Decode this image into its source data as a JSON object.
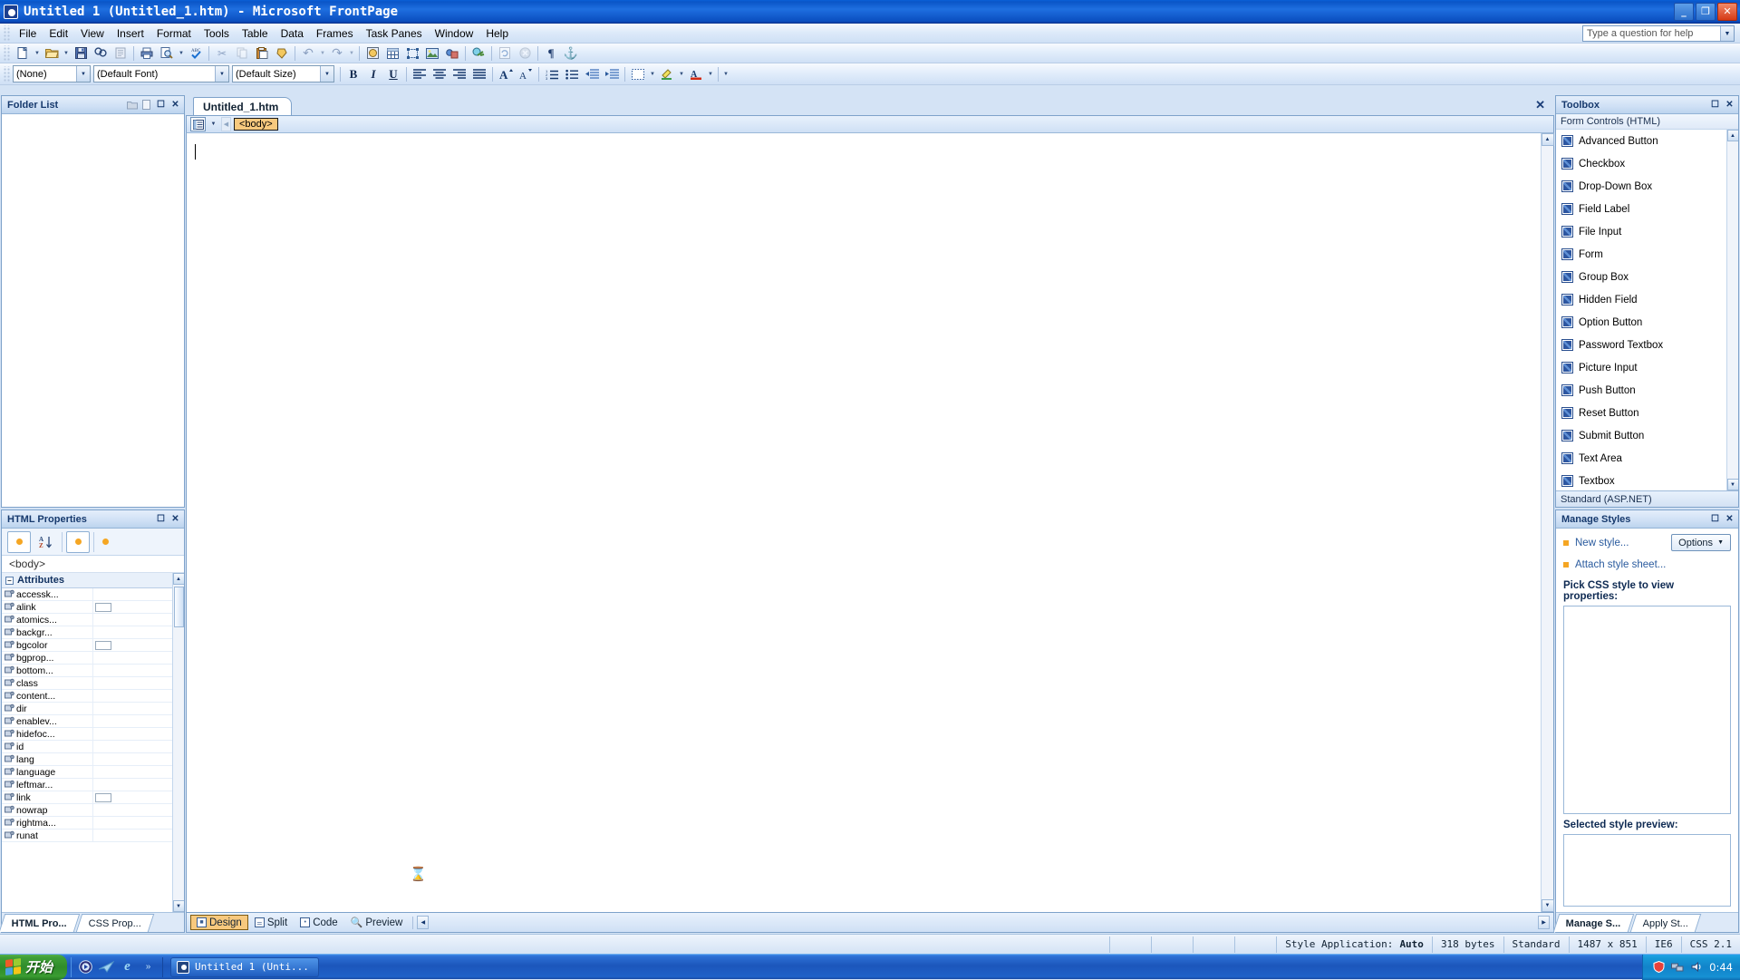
{
  "window": {
    "title": "Untitled 1 (Untitled_1.htm) - Microsoft FrontPage",
    "icon": "frontpage-icon",
    "minimize": "_",
    "maximize": "❐",
    "close": "✕"
  },
  "menubar": {
    "items": [
      "File",
      "Edit",
      "View",
      "Insert",
      "Format",
      "Tools",
      "Table",
      "Data",
      "Frames",
      "Task Panes",
      "Window",
      "Help"
    ],
    "help_box": {
      "placeholder": "Type a question for help",
      "value": ""
    }
  },
  "standard_toolbar": {
    "buttons": [
      {
        "name": "new-page-button",
        "glyph": "□"
      },
      {
        "name": "new-page-dropdown",
        "glyph": "▾"
      },
      {
        "name": "open-button",
        "glyph": "📂"
      },
      {
        "name": "open-dropdown",
        "glyph": "▾"
      },
      {
        "name": "save-button",
        "glyph": "💾"
      },
      {
        "name": "search-button",
        "glyph": "🔍"
      },
      {
        "name": "publish-site-button",
        "glyph": "≣"
      },
      {
        "name": "print-button",
        "glyph": "🖨"
      },
      {
        "name": "print-preview-button",
        "glyph": "🔎"
      },
      {
        "name": "print-preview-dropdown",
        "glyph": "▾"
      },
      {
        "name": "spelling-button",
        "glyph": "✔"
      },
      {
        "name": "cut-button",
        "glyph": "✂"
      },
      {
        "name": "copy-button",
        "glyph": "❐"
      },
      {
        "name": "paste-button",
        "glyph": "📋"
      },
      {
        "name": "format-painter-button",
        "glyph": "✒"
      },
      {
        "name": "undo-button",
        "glyph": "↶"
      },
      {
        "name": "undo-dropdown",
        "glyph": "▾"
      },
      {
        "name": "redo-button",
        "glyph": "↷"
      },
      {
        "name": "redo-dropdown",
        "glyph": "▾"
      },
      {
        "name": "web-component-button",
        "glyph": "🌐"
      },
      {
        "name": "insert-table-button",
        "glyph": "▦"
      },
      {
        "name": "insert-layer-button",
        "glyph": "⬚"
      },
      {
        "name": "insert-picture-button",
        "glyph": "🖼"
      },
      {
        "name": "drawing-button",
        "glyph": "✎"
      },
      {
        "name": "insert-hyperlink-button",
        "glyph": "🔗"
      },
      {
        "name": "refresh-button",
        "glyph": "❐"
      },
      {
        "name": "stop-button",
        "glyph": "✕"
      },
      {
        "name": "show-marks-button",
        "glyph": "¶"
      },
      {
        "name": "show-anchors-button",
        "glyph": "⚓"
      }
    ]
  },
  "formatting_toolbar": {
    "style_combo": {
      "value": "(None)",
      "name": "style-combo"
    },
    "font_combo": {
      "value": "(Default Font)",
      "name": "font-combo"
    },
    "size_combo": {
      "value": "(Default Size)",
      "name": "font-size-combo"
    },
    "bold": "B",
    "italic": "I",
    "underline": "U",
    "buttons": [
      {
        "name": "align-left-button",
        "glyph": "≡"
      },
      {
        "name": "align-center-button",
        "glyph": "≡"
      },
      {
        "name": "align-right-button",
        "glyph": "≡"
      },
      {
        "name": "justify-button",
        "glyph": "≡"
      },
      {
        "name": "increase-font-size-button",
        "glyph": "A"
      },
      {
        "name": "decrease-font-size-button",
        "glyph": "A"
      },
      {
        "name": "numbered-list-button",
        "glyph": "≡"
      },
      {
        "name": "bulleted-list-button",
        "glyph": "≡"
      },
      {
        "name": "decrease-indent-button",
        "glyph": "⇤"
      },
      {
        "name": "increase-indent-button",
        "glyph": "⇥"
      },
      {
        "name": "borders-button",
        "glyph": "⬚"
      },
      {
        "name": "borders-dropdown",
        "glyph": "▾"
      },
      {
        "name": "highlight-button",
        "glyph": "✏"
      },
      {
        "name": "highlight-dropdown",
        "glyph": "▾"
      },
      {
        "name": "font-color-button",
        "glyph": "A"
      },
      {
        "name": "font-color-dropdown",
        "glyph": "▾"
      },
      {
        "name": "toolbar-options-button",
        "glyph": "▾"
      }
    ]
  },
  "folder_list": {
    "title": "Folder List",
    "header_icons": [
      "new-folder-icon",
      "new-page-icon",
      "maximize-icon",
      "close-icon"
    ],
    "items": []
  },
  "html_properties": {
    "title": "HTML Properties",
    "header_icons": [
      "maximize-icon",
      "close-icon"
    ],
    "toolbar": [
      "categorized-button",
      "alphabetical-button",
      "properties-button",
      "events-button"
    ],
    "az_label": "AZ",
    "selected_tag": "<body>",
    "attributes_group": "Attributes",
    "attributes": [
      {
        "name": "accessk...",
        "value": "",
        "has_swatch": false
      },
      {
        "name": "alink",
        "value": "",
        "has_swatch": true
      },
      {
        "name": "atomics...",
        "value": "",
        "has_swatch": false
      },
      {
        "name": "backgr...",
        "value": "",
        "has_swatch": false
      },
      {
        "name": "bgcolor",
        "value": "",
        "has_swatch": true
      },
      {
        "name": "bgprop...",
        "value": "",
        "has_swatch": false
      },
      {
        "name": "bottom...",
        "value": "",
        "has_swatch": false
      },
      {
        "name": "class",
        "value": "",
        "has_swatch": false
      },
      {
        "name": "content...",
        "value": "",
        "has_swatch": false
      },
      {
        "name": "dir",
        "value": "",
        "has_swatch": false
      },
      {
        "name": "enablev...",
        "value": "",
        "has_swatch": false
      },
      {
        "name": "hidefoc...",
        "value": "",
        "has_swatch": false
      },
      {
        "name": "id",
        "value": "",
        "has_swatch": false
      },
      {
        "name": "lang",
        "value": "",
        "has_swatch": false
      },
      {
        "name": "language",
        "value": "",
        "has_swatch": false
      },
      {
        "name": "leftmar...",
        "value": "",
        "has_swatch": false
      },
      {
        "name": "link",
        "value": "",
        "has_swatch": true
      },
      {
        "name": "nowrap",
        "value": "",
        "has_swatch": false
      },
      {
        "name": "rightma...",
        "value": "",
        "has_swatch": false
      },
      {
        "name": "runat",
        "value": "",
        "has_swatch": false
      }
    ],
    "tabs": [
      {
        "label": "HTML Pro...",
        "active": true
      },
      {
        "label": "CSS Prop...",
        "active": false
      }
    ]
  },
  "document": {
    "tab_label": "Untitled_1.htm",
    "close_label": "✕",
    "quick_tag_selector": "<body>",
    "canvas_text": "",
    "hourglass_icon": "⌛"
  },
  "view_tabs": [
    {
      "label": "Design",
      "active": true,
      "icon": "design-icon"
    },
    {
      "label": "Split",
      "active": false,
      "icon": "split-icon"
    },
    {
      "label": "Code",
      "active": false,
      "icon": "code-icon"
    },
    {
      "label": "Preview",
      "active": false,
      "icon": "preview-icon"
    }
  ],
  "toolbox": {
    "title": "Toolbox",
    "header_icons": [
      "maximize-icon",
      "close-icon"
    ],
    "category": "Form Controls (HTML)",
    "items": [
      "Advanced Button",
      "Checkbox",
      "Drop-Down Box",
      "Field Label",
      "File Input",
      "Form",
      "Group Box",
      "Hidden Field",
      "Option Button",
      "Password Textbox",
      "Picture Input",
      "Push Button",
      "Reset Button",
      "Submit Button",
      "Text Area",
      "Textbox"
    ],
    "category2": "Standard (ASP.NET)"
  },
  "manage_styles": {
    "title": "Manage Styles",
    "header_icons": [
      "maximize-icon",
      "close-icon"
    ],
    "new_style": "New style...",
    "options_button": "Options",
    "attach_style_sheet": "Attach style sheet...",
    "pick_label": "Pick CSS style to view properties:",
    "preview_label": "Selected style preview:",
    "tabs": [
      {
        "label": "Manage S...",
        "active": true
      },
      {
        "label": "Apply St...",
        "active": false
      }
    ]
  },
  "status_bar": {
    "style_application_label": "Style Application:",
    "style_application_value": "Auto",
    "page_size": "318 bytes",
    "schema": "Standard",
    "dimensions": "1487 x 851",
    "browser": "IE6",
    "css_version": "CSS 2.1"
  },
  "taskbar": {
    "start_label": "开始",
    "quick_launch": [
      "media-player-icon",
      "outlook-icon",
      "internet-explorer-icon",
      "chevron-double-right-icon"
    ],
    "tasks": [
      {
        "label": "Untitled 1 (Unti...",
        "icon": "frontpage-icon",
        "active": true
      }
    ],
    "tray": {
      "icons": [
        "shield-icon",
        "network-icon",
        "volume-icon"
      ],
      "clock": "0:44"
    }
  }
}
